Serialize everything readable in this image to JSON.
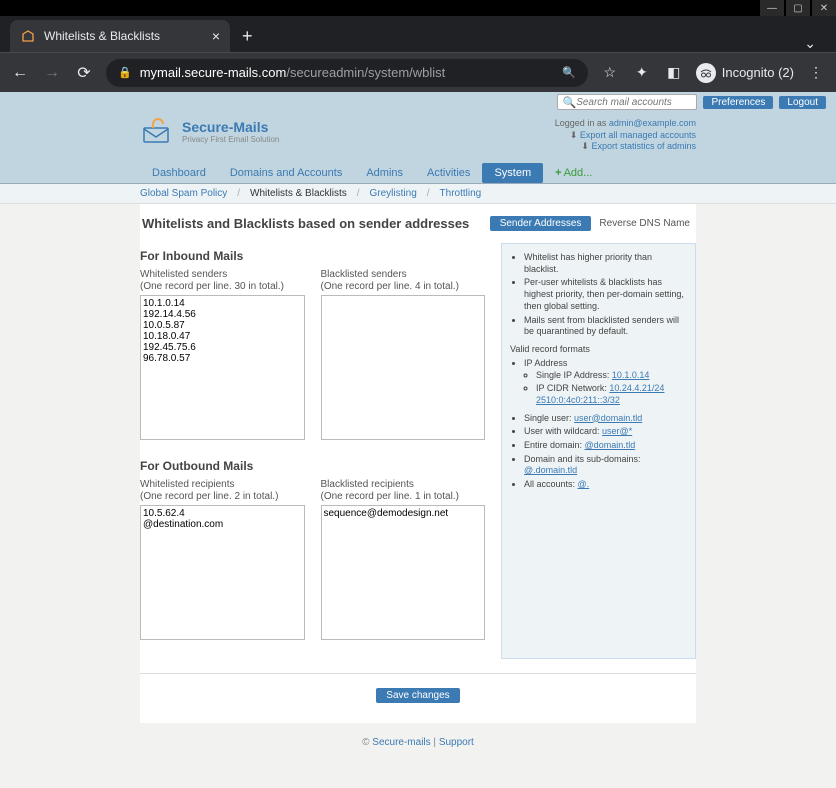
{
  "browser": {
    "tab_title": "Whitelists & Blacklists",
    "url_domain": "mymail.secure-mails.com",
    "url_path": "/secureadmin/system/wblist",
    "incognito_label": "Incognito (2)"
  },
  "header": {
    "search_placeholder": "Search mail accounts",
    "preferences": "Preferences",
    "logout": "Logout",
    "brand_name": "Secure-Mails",
    "brand_tag": "Privacy First Email Solution",
    "logged_in_prefix": "Logged in as ",
    "logged_in_user": "admin@example.com",
    "export_accounts": "Export all managed accounts",
    "export_admins": "Export statistics of admins"
  },
  "nav": {
    "items": [
      "Dashboard",
      "Domains and Accounts",
      "Admins",
      "Activities",
      "System"
    ],
    "add": "Add..."
  },
  "subnav": {
    "items": [
      "Global Spam Policy",
      "Whitelists & Blacklists",
      "Greylisting",
      "Throttling"
    ],
    "active_index": 1
  },
  "page": {
    "title": "Whitelists and Blacklists based on sender addresses",
    "sender_addresses": "Sender Addresses",
    "reverse_dns": "Reverse DNS Name",
    "inbound_title": "For Inbound Mails",
    "outbound_title": "For Outbound Mails",
    "whitelisted_senders_label": "Whitelisted senders",
    "whitelisted_senders_sub": "(One record per line. 30 in total.)",
    "blacklisted_senders_label": "Blacklisted senders",
    "blacklisted_senders_sub": "(One record per line. 4 in total.)",
    "whitelisted_recipients_label": "Whitelisted recipients",
    "whitelisted_recipients_sub": "(One record per line. 2 in total.)",
    "blacklisted_recipients_label": "Blacklisted recipients",
    "blacklisted_recipients_sub": "(One record per line. 1 in total.)",
    "whitelisted_senders_value": "10.1.0.14\n192.14.4.56\n10.0.5.87\n10.18.0.47\n192.45.75.6\n96.78.0.57",
    "blacklisted_senders_value": "",
    "whitelisted_recipients_value": "10.5.62.4\n@destination.com",
    "blacklisted_recipients_value": "sequence@demodesign.net",
    "save_label": "Save changes"
  },
  "help": {
    "bullets": [
      "Whitelist has higher priority than blacklist.",
      "Per-user whitelists & blacklists has highest priority, then per-domain setting, then global setting.",
      "Mails sent from blacklisted senders will be quarantined by default."
    ],
    "valid_formats": "Valid record formats",
    "ip_address": "IP Address",
    "single_ip": "Single IP Address:",
    "single_ip_ex": "10.1.0.14",
    "ip_cidr": "IP CIDR Network:",
    "ip_cidr_ex": "10.24.4.21/24",
    "ip_cidr_ex2": "2510:0:4c0:211::3/32",
    "single_user": "Single user:",
    "single_user_ex": "user@domain.tld",
    "wildcard": "User with wildcard:",
    "wildcard_ex": "user@*",
    "entire_domain": "Entire domain:",
    "entire_domain_ex": "@domain.tld",
    "subdomains": "Domain and its sub-domains:",
    "subdomains_ex": "@.domain.tld",
    "all_accounts": "All accounts:",
    "all_accounts_ex": "@."
  },
  "footer": {
    "copyright": "© ",
    "brand": "Secure-mails",
    "sep": " | ",
    "support": "Support"
  }
}
